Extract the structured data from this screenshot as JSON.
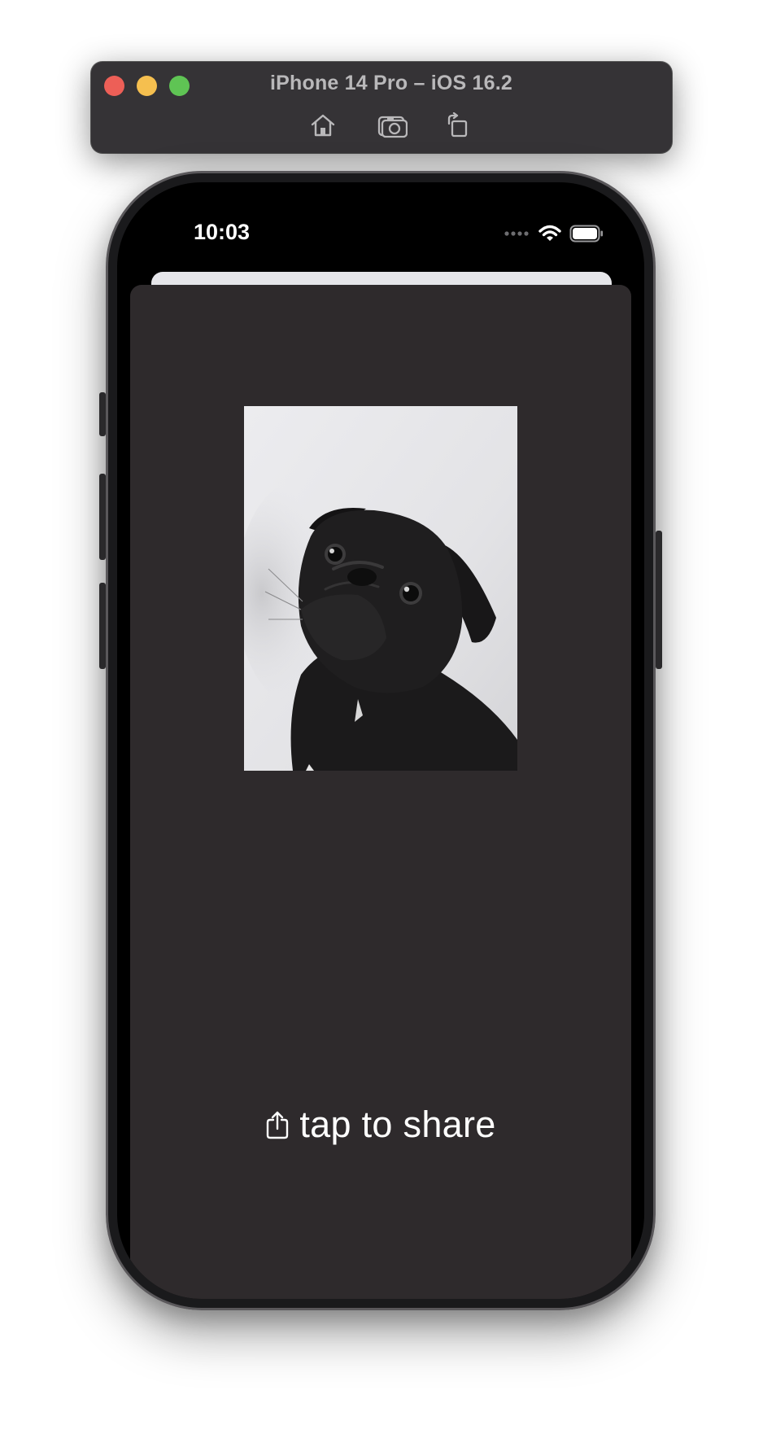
{
  "simulator": {
    "title": "iPhone 14 Pro – iOS 16.2",
    "toolbar": [
      {
        "icon": "home-icon",
        "name": "Home"
      },
      {
        "icon": "camera-icon",
        "name": "Screenshot"
      },
      {
        "icon": "rotate-icon",
        "name": "Rotate"
      }
    ],
    "traffic_lights": {
      "close": "#ed5f57",
      "minimize": "#f5bf4f",
      "zoom": "#5fc454"
    }
  },
  "status_bar": {
    "time": "10:03",
    "icons": [
      "signal-dots-icon",
      "wifi-icon",
      "battery-icon"
    ]
  },
  "app": {
    "image_subject": "black-and-white photo of a pug",
    "share_label": "tap to share",
    "share_icon": "share-icon",
    "colors": {
      "sheet_background": "#2e2a2c",
      "text": "#ffffff"
    }
  }
}
